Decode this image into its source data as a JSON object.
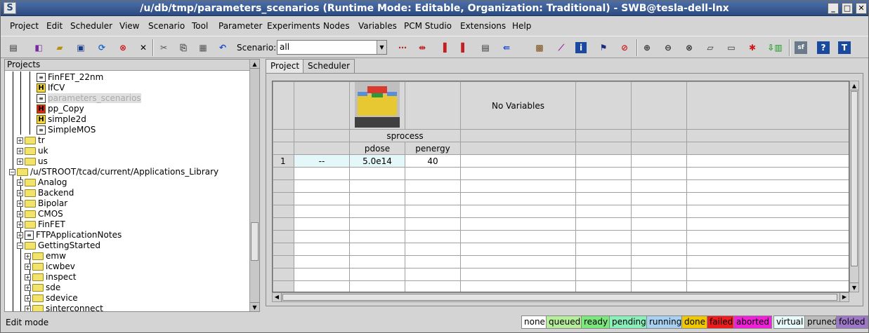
{
  "window": {
    "title": "/u/db/tmp/parameters_scenarios (Runtime Mode: Editable, Organization: Traditional) - SWB@tesla-dell-lnx",
    "app_icon": "S",
    "min": "_",
    "max": "□",
    "close": "✕"
  },
  "menu": [
    "Project",
    "Edit",
    "Scheduler",
    "View",
    "Scenario",
    "Tool",
    "Parameter",
    "Experiments",
    "Nodes",
    "Variables",
    "PCM Studio",
    "Extensions",
    "Help"
  ],
  "toolbar": {
    "scenario_label": "Scenario:",
    "scenario_value": "all"
  },
  "projects_header": "Projects",
  "tree": [
    {
      "label": "FinFET_22nm",
      "icon": "doc"
    },
    {
      "label": "IfCV",
      "icon": "h"
    },
    {
      "label": "parameters_scenarios",
      "icon": "doc",
      "selected": true
    },
    {
      "label": "pp_Copy",
      "icon": "hred"
    },
    {
      "label": "simple2d",
      "icon": "h"
    },
    {
      "label": "SimpleMOS",
      "icon": "doc"
    },
    {
      "label": "tr",
      "icon": "folder"
    },
    {
      "label": "uk",
      "icon": "folder"
    },
    {
      "label": "us",
      "icon": "folder"
    },
    {
      "label": "/u/STROOT/tcad/current/Applications_Library",
      "icon": "folder"
    },
    {
      "label": "Analog",
      "icon": "folder"
    },
    {
      "label": "Backend",
      "icon": "folder"
    },
    {
      "label": "Bipolar",
      "icon": "folder"
    },
    {
      "label": "CMOS",
      "icon": "folder"
    },
    {
      "label": "FinFET",
      "icon": "folder"
    },
    {
      "label": "FTPApplicationNotes",
      "icon": "doc"
    },
    {
      "label": "GettingStarted",
      "icon": "folder"
    },
    {
      "label": "emw",
      "icon": "folder"
    },
    {
      "label": "icwbev",
      "icon": "folder"
    },
    {
      "label": "inspect",
      "icon": "folder"
    },
    {
      "label": "sde",
      "icon": "folder"
    },
    {
      "label": "sdevice",
      "icon": "folder"
    },
    {
      "label": "sinterconnect",
      "icon": "folder"
    }
  ],
  "tabs": {
    "project": "Project",
    "scheduler": "Scheduler"
  },
  "grid": {
    "tool_name": "sprocess",
    "tool_icon_label": "SPROCESS",
    "no_vars": "No Variables",
    "params": [
      "pdose",
      "penergy"
    ],
    "row": {
      "num": "1",
      "first": "--",
      "pdose": "5.0e14",
      "penergy": "40"
    }
  },
  "status": {
    "text": "Edit mode",
    "legend": [
      "none",
      "queued",
      "ready",
      "pending",
      "running",
      "done",
      "failed",
      "aborted",
      "virtual",
      "pruned",
      "folded"
    ]
  }
}
